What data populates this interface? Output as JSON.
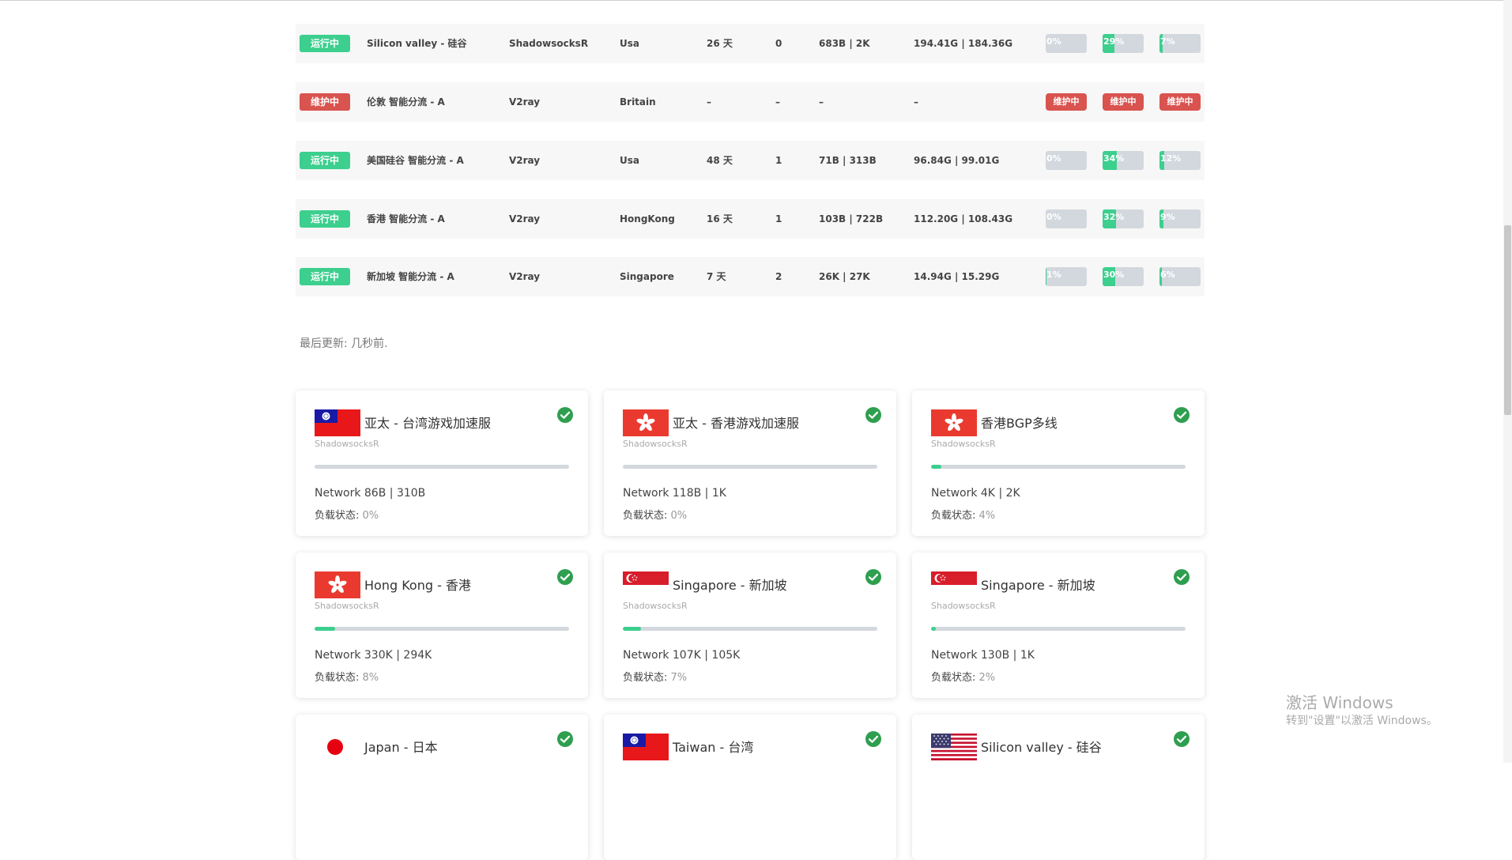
{
  "nodes": [
    {
      "status": "运行中",
      "status_type": "running",
      "name": "Silicon valley - 硅谷",
      "protocol": "ShadowsocksR",
      "location": "Usa",
      "uptime": "26 天",
      "load": "0",
      "network": "683B | 2K",
      "traffic": "194.41G | 184.36G",
      "cpu": "0%",
      "cpu_value": 0,
      "mem": "29%",
      "mem_value": 29,
      "disk": "7%",
      "disk_value": 7
    },
    {
      "status": "维护中",
      "status_type": "maint",
      "name": "伦敦 智能分流 - A",
      "protocol": "V2ray",
      "location": "Britain",
      "uptime": "–",
      "load": "–",
      "network": "–",
      "traffic": "–",
      "cpu": "维护中",
      "mem": "维护中",
      "disk": "维护中"
    },
    {
      "status": "运行中",
      "status_type": "running",
      "name": "美国硅谷 智能分流 - A",
      "protocol": "V2ray",
      "location": "Usa",
      "uptime": "48 天",
      "load": "1",
      "network": "71B | 313B",
      "traffic": "96.84G | 99.01G",
      "cpu": "0%",
      "cpu_value": 0,
      "mem": "34%",
      "mem_value": 34,
      "disk": "12%",
      "disk_value": 12
    },
    {
      "status": "运行中",
      "status_type": "running",
      "name": "香港 智能分流 - A",
      "protocol": "V2ray",
      "location": "HongKong",
      "uptime": "16 天",
      "load": "1",
      "network": "103B | 722B",
      "traffic": "112.20G | 108.43G",
      "cpu": "0%",
      "cpu_value": 0,
      "mem": "32%",
      "mem_value": 32,
      "disk": "9%",
      "disk_value": 9
    },
    {
      "status": "运行中",
      "status_type": "running",
      "name": "新加坡 智能分流 - A",
      "protocol": "V2ray",
      "location": "Singapore",
      "uptime": "7 天",
      "load": "2",
      "network": "26K | 27K",
      "traffic": "14.94G | 15.29G",
      "cpu": "1%",
      "cpu_value": 1,
      "mem": "30%",
      "mem_value": 30,
      "disk": "6%",
      "disk_value": 6
    }
  ],
  "last_update": "最后更新: 几秒前.",
  "cards": [
    {
      "flag": "taiwan",
      "title": "亚太 - 台湾游戏加速服",
      "protocol": "ShadowsocksR",
      "load_value": 0,
      "network": "Network 86B | 310B",
      "load_label": "负载状态:",
      "load": "0%"
    },
    {
      "flag": "hongkong",
      "title": "亚太 - 香港游戏加速服",
      "protocol": "ShadowsocksR",
      "load_value": 0,
      "network": "Network 118B | 1K",
      "load_label": "负载状态:",
      "load": "0%"
    },
    {
      "flag": "hongkong",
      "title": "香港BGP多线",
      "protocol": "ShadowsocksR",
      "load_value": 4,
      "network": "Network 4K | 2K",
      "load_label": "负载状态:",
      "load": "4%"
    },
    {
      "flag": "hongkong",
      "title": "Hong Kong - 香港",
      "protocol": "ShadowsocksR",
      "load_value": 8,
      "network": "Network 330K | 294K",
      "load_label": "负载状态:",
      "load": "8%"
    },
    {
      "flag": "singapore",
      "title": "Singapore - 新加坡",
      "protocol": "ShadowsocksR",
      "load_value": 7,
      "network": "Network 107K | 105K",
      "load_label": "负载状态:",
      "load": "7%"
    },
    {
      "flag": "singapore",
      "title": "Singapore - 新加坡",
      "protocol": "ShadowsocksR",
      "load_value": 2,
      "network": "Network 130B | 1K",
      "load_label": "负载状态:",
      "load": "2%"
    },
    {
      "flag": "japan",
      "title": "Japan - 日本"
    },
    {
      "flag": "taiwan",
      "title": "Taiwan - 台湾"
    },
    {
      "flag": "usa",
      "title": "Silicon valley - 硅谷"
    }
  ],
  "watermark": {
    "title": "激活 Windows",
    "subtitle": "转到\"设置\"以激活 Windows。"
  },
  "colors": {
    "running": "#3ccf8e",
    "maintenance": "#d9534f",
    "check": "#2e9e4f"
  }
}
